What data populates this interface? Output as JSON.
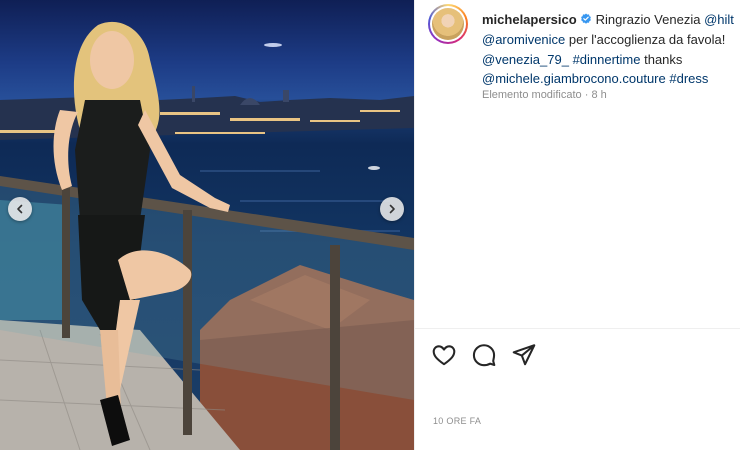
{
  "post": {
    "carousel": {
      "prev_icon": "chevron-left-icon",
      "next_icon": "chevron-right-icon"
    },
    "author": {
      "username": "michelapersico",
      "verified": true
    },
    "caption": {
      "line1_text": "Ringrazio Venezia",
      "line1_tag": "@hilt",
      "line2_tag": "@aromivenice",
      "line2_text": " per l'accoglienza da favola!",
      "line3_tag1": "@venezia_79_",
      "line3_tag2": "#dinnertime",
      "line3_text": " thanks",
      "line4_tag1": "@michele.giambrocono.couture",
      "line4_tag2": "#dress"
    },
    "meta": {
      "edited": "Elemento modificato",
      "separator": "·",
      "age": "8 h"
    },
    "actions": [
      {
        "name": "like",
        "icon": "heart-icon"
      },
      {
        "name": "comment",
        "icon": "comment-bubble-icon"
      },
      {
        "name": "share",
        "icon": "paper-plane-icon"
      }
    ],
    "timestamp": "10 ORE FA"
  },
  "colors": {
    "tag": "#00376b",
    "muted": "#8e8e8e",
    "verified": "#3897f0"
  }
}
